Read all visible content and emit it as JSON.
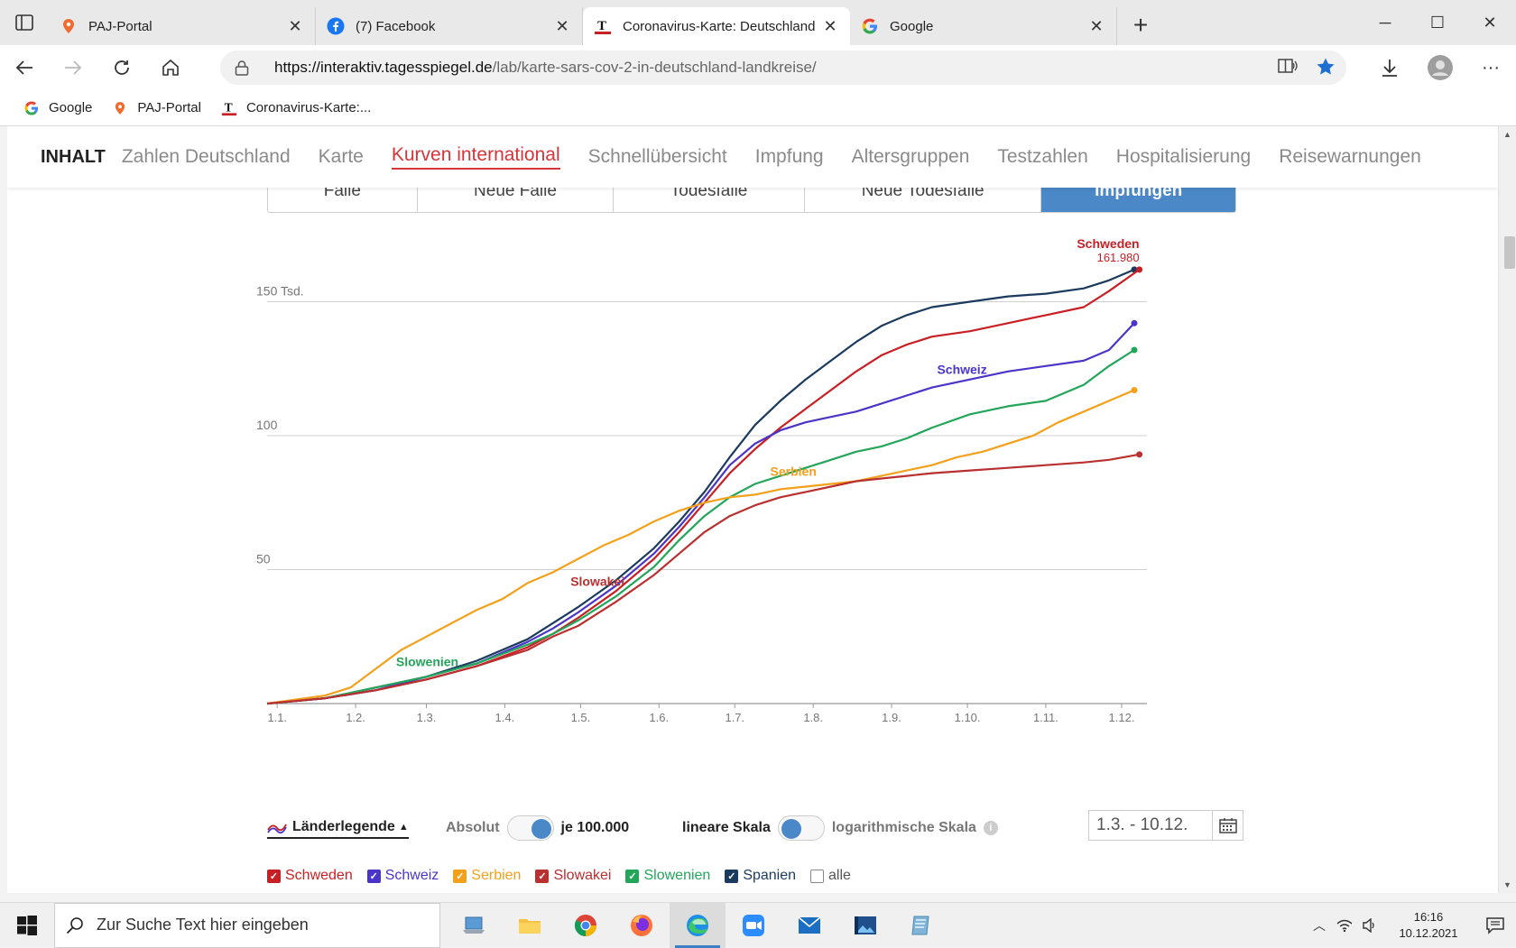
{
  "browser": {
    "tabs": [
      {
        "title": "PAJ-Portal",
        "icon": "pin-icon",
        "active": false
      },
      {
        "title": "(7) Facebook",
        "icon": "facebook-icon",
        "active": false
      },
      {
        "title": "Coronavirus-Karte: Deutschland",
        "icon": "tagesspiegel-icon",
        "active": true
      },
      {
        "title": "Google",
        "icon": "google-icon",
        "active": false
      }
    ],
    "url_host": "https://interaktiv.tagesspiegel.de",
    "url_path": "/lab/karte-sars-cov-2-in-deutschland-landkreise/",
    "bookmarks": [
      {
        "label": "Google",
        "icon": "google-icon"
      },
      {
        "label": "PAJ-Portal",
        "icon": "pin-icon"
      },
      {
        "label": "Coronavirus-Karte:...",
        "icon": "tagesspiegel-icon"
      }
    ]
  },
  "nav": {
    "inhalt": "INHALT",
    "items": [
      "Zahlen Deutschland",
      "Karte",
      "Kurven international",
      "Schnellübersicht",
      "Impfung",
      "Altersgruppen",
      "Testzahlen",
      "Hospitalisierung",
      "Reisewarnungen"
    ],
    "active_index": 2
  },
  "subtabs": {
    "items": [
      "Fälle",
      "Neue Fälle",
      "Todesfälle",
      "Neue Todesfälle",
      "Impfungen"
    ],
    "active_index": 4
  },
  "chart_data": {
    "type": "line",
    "ylim": [
      0,
      165
    ],
    "y_ticks": [
      {
        "value": 50,
        "label": "50"
      },
      {
        "value": 100,
        "label": "100"
      },
      {
        "value": 150,
        "label": "150 Tsd."
      }
    ],
    "x_categories": [
      "1.1.",
      "1.2.",
      "1.3.",
      "1.4.",
      "1.5.",
      "1.6.",
      "1.7.",
      "1.8.",
      "1.9.",
      "1.10.",
      "1.11.",
      "1.12."
    ],
    "x_day_of_year": [
      1,
      32,
      60,
      91,
      121,
      152,
      182,
      213,
      244,
      274,
      305,
      335
    ],
    "x_range": [
      -3,
      345
    ],
    "series": [
      {
        "name": "Spanien",
        "color": "#1b3b5e",
        "x": [
          -3,
          20,
          40,
          60,
          80,
          100,
          110,
          120,
          135,
          150,
          160,
          170,
          180,
          190,
          200,
          210,
          220,
          230,
          240,
          250,
          260,
          275,
          290,
          305,
          320,
          330,
          340
        ],
        "y": [
          0,
          2,
          6,
          10,
          16,
          24,
          30,
          36,
          46,
          58,
          68,
          79,
          92,
          104,
          113,
          121,
          128,
          135,
          141,
          145,
          148,
          150,
          152,
          153,
          155,
          158,
          162
        ]
      },
      {
        "name": "Schweden",
        "color": "#c81f24",
        "x": [
          -3,
          20,
          40,
          60,
          80,
          100,
          110,
          120,
          135,
          150,
          160,
          170,
          180,
          190,
          200,
          210,
          220,
          230,
          240,
          250,
          260,
          275,
          290,
          305,
          320,
          330,
          342
        ],
        "y": [
          0,
          2,
          5,
          9,
          14,
          21,
          26,
          32,
          42,
          54,
          64,
          75,
          86,
          95,
          103,
          110,
          117,
          124,
          130,
          134,
          137,
          139,
          142,
          145,
          148,
          154,
          162
        ],
        "end_label": "Schweden",
        "end_value": "161.980"
      },
      {
        "name": "Schweiz",
        "color": "#4b35c8",
        "x": [
          -3,
          20,
          40,
          60,
          80,
          100,
          110,
          120,
          135,
          150,
          160,
          170,
          180,
          190,
          200,
          210,
          220,
          230,
          240,
          250,
          260,
          275,
          290,
          305,
          320,
          330,
          340
        ],
        "y": [
          0,
          2,
          5,
          10,
          15,
          23,
          28,
          34,
          44,
          56,
          66,
          77,
          89,
          97,
          102,
          105,
          107,
          109,
          112,
          115,
          118,
          121,
          124,
          126,
          128,
          132,
          142
        ],
        "label": "Schweiz",
        "label_x": 262,
        "label_y": 123
      },
      {
        "name": "Slowenien",
        "color": "#23a55a",
        "x": [
          -3,
          20,
          40,
          60,
          80,
          100,
          110,
          120,
          135,
          150,
          160,
          170,
          180,
          190,
          200,
          210,
          220,
          230,
          240,
          250,
          260,
          275,
          290,
          305,
          320,
          330,
          340
        ],
        "y": [
          0,
          2,
          6,
          10,
          15,
          22,
          26,
          31,
          40,
          51,
          61,
          70,
          77,
          82,
          85,
          88,
          91,
          94,
          96,
          99,
          103,
          108,
          111,
          113,
          119,
          126,
          132
        ],
        "label": "Slowenien",
        "label_x": 48,
        "label_y": 14
      },
      {
        "name": "Serbien",
        "color": "#f3a01b",
        "x": [
          -3,
          20,
          30,
          40,
          50,
          60,
          70,
          80,
          90,
          100,
          110,
          120,
          130,
          140,
          150,
          160,
          170,
          180,
          190,
          200,
          210,
          220,
          230,
          240,
          250,
          260,
          270,
          280,
          290,
          300,
          310,
          320,
          330,
          340
        ],
        "y": [
          0,
          3,
          6,
          13,
          20,
          25,
          30,
          35,
          39,
          45,
          49,
          54,
          59,
          63,
          68,
          72,
          75,
          77,
          78,
          80,
          81,
          82,
          83,
          85,
          87,
          89,
          92,
          94,
          97,
          100,
          105,
          109,
          113,
          117
        ],
        "label": "Serbien",
        "label_x": 196,
        "label_y": 85
      },
      {
        "name": "Slowakei",
        "color": "#b93030",
        "x": [
          -3,
          20,
          40,
          60,
          80,
          100,
          110,
          120,
          135,
          150,
          160,
          170,
          180,
          190,
          200,
          210,
          220,
          230,
          240,
          250,
          260,
          275,
          290,
          305,
          320,
          330,
          342
        ],
        "y": [
          0,
          2,
          5,
          9,
          14,
          20,
          25,
          29,
          38,
          48,
          56,
          64,
          70,
          74,
          77,
          79,
          81,
          83,
          84,
          85,
          86,
          87,
          88,
          89,
          90,
          91,
          93
        ],
        "label": "Slowakei",
        "label_x": 117,
        "label_y": 44
      }
    ]
  },
  "controls": {
    "legend_label": "Länderlegende",
    "absolut_label": "Absolut",
    "je_label": "je 100.000",
    "linear_label": "lineare Skala",
    "log_label": "logarithmische Skala",
    "info": "i",
    "date_range": "1.3. - 10.12."
  },
  "countries": [
    {
      "label": "Schweden",
      "color": "#c81f24",
      "checked": true
    },
    {
      "label": "Schweiz",
      "color": "#4b35c8",
      "checked": true
    },
    {
      "label": "Serbien",
      "color": "#f3a01b",
      "checked": true
    },
    {
      "label": "Slowakei",
      "color": "#b93030",
      "checked": true
    },
    {
      "label": "Slowenien",
      "color": "#23a55a",
      "checked": true
    },
    {
      "label": "Spanien",
      "color": "#1b3b5e",
      "checked": true
    },
    {
      "label": "alle",
      "color": "#888888",
      "checked": false
    }
  ],
  "taskbar": {
    "search_placeholder": "Zur Suche Text hier eingeben",
    "time": "16:16",
    "date": "10.12.2021"
  }
}
